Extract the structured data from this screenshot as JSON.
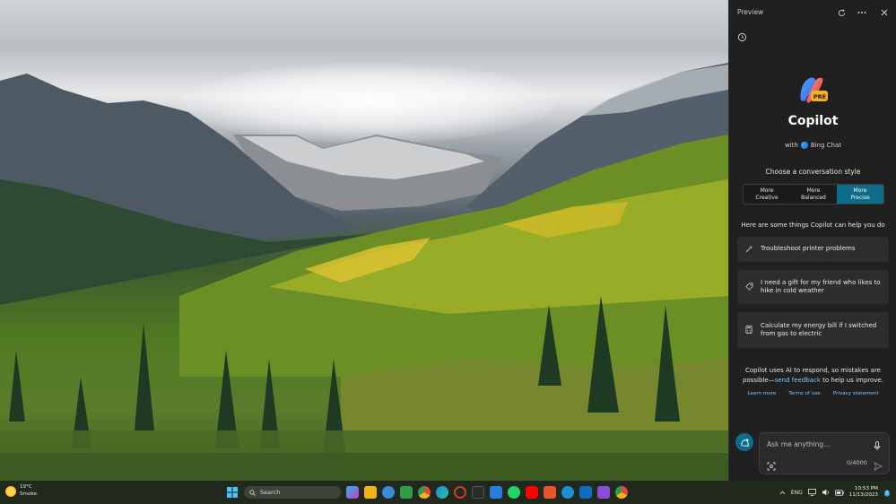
{
  "panel": {
    "title": "Preview",
    "header_icons": [
      "refresh-icon",
      "more-icon",
      "close-icon"
    ],
    "logo_badge": "PRE",
    "brand": "Copilot",
    "with_prefix": "with",
    "with_product": "Bing Chat",
    "choose_label": "Choose a conversation style",
    "styles": [
      {
        "label": "More\nCreative",
        "active": false
      },
      {
        "label": "More\nBalanced",
        "active": false
      },
      {
        "label": "More\nPrecise",
        "active": true
      }
    ],
    "help_heading": "Here are some things Copilot can help you do",
    "suggestions": [
      {
        "icon": "wand-icon",
        "text": "Troubleshoot printer problems"
      },
      {
        "icon": "tag-icon",
        "text": "I need a gift for my friend who likes to hike in cold weather"
      },
      {
        "icon": "calculator-icon",
        "text": "Calculate my energy bill if I switched from gas to electric"
      }
    ],
    "disclaimer_a": "Copilot uses AI to respond, so mistakes are possible—",
    "disclaimer_link": "send feedback",
    "disclaimer_b": " to help us improve.",
    "links": [
      "Learn more",
      "Terms of use",
      "Privacy statement"
    ],
    "chat_placeholder": "Ask me anything...",
    "counter": "0/4000"
  },
  "taskbar": {
    "temperature": "19°C",
    "condition": "Smoke",
    "search_label": "Search",
    "language": "ENG",
    "time": "10:53 PM",
    "date": "11/13/2023",
    "app_colors": [
      "#c83cb8",
      "#f2b41a",
      "#3c8cd8",
      "#2e9d4a",
      "#e34a3a",
      "#1e88e5",
      "#d23a2c",
      "#2a2a2a",
      "#2c7de0",
      "#25d366",
      "#ff0000",
      "#e8542c",
      "#1e8fd6",
      "#0f6cbd",
      "#8a4fd8",
      "#e34a3a"
    ]
  },
  "colors": {
    "accent": "#0e6b8a",
    "link": "#7ec8ff",
    "panel_bg": "#202020"
  }
}
